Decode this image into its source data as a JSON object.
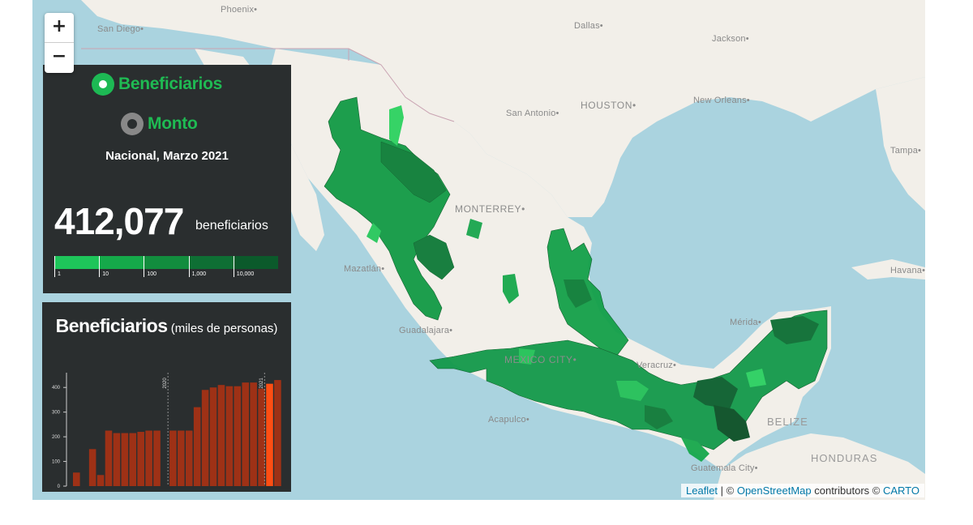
{
  "map": {
    "cities": [
      {
        "name": "Phoenix",
        "cls": "",
        "x": 232,
        "y": 6
      },
      {
        "name": "San Diego",
        "cls": "",
        "x": 80,
        "y": 30
      },
      {
        "name": "Dallas",
        "cls": "",
        "x": 668,
        "y": 26
      },
      {
        "name": "Jackson",
        "cls": "",
        "x": 838,
        "y": 42
      },
      {
        "name": "HOUSTON",
        "cls": "big",
        "x": 676,
        "y": 123
      },
      {
        "name": "San Antonio",
        "cls": "",
        "x": 584,
        "y": 134
      },
      {
        "name": "New Orleans",
        "cls": "",
        "x": 815,
        "y": 118
      },
      {
        "name": "Tampa",
        "cls": "",
        "x": 1058,
        "y": 180
      },
      {
        "name": "MONTERREY",
        "cls": "big",
        "x": 521,
        "y": 251
      },
      {
        "name": "Mazatlán",
        "cls": "",
        "x": 384,
        "y": 326
      },
      {
        "name": "Havana",
        "cls": "",
        "x": 1058,
        "y": 328
      },
      {
        "name": "Guadalajara",
        "cls": "",
        "x": 452,
        "y": 402
      },
      {
        "name": "Mérida",
        "cls": "",
        "x": 860,
        "y": 392
      },
      {
        "name": "MEXICO CITY",
        "cls": "big",
        "x": 582,
        "y": 437
      },
      {
        "name": "Veracruz",
        "cls": "",
        "x": 745,
        "y": 445
      },
      {
        "name": "Acapulco",
        "cls": "",
        "x": 562,
        "y": 512
      },
      {
        "name": "BELIZE",
        "cls": "country",
        "x": 906,
        "y": 513
      },
      {
        "name": "HONDURAS",
        "cls": "country",
        "x": 960,
        "y": 558
      },
      {
        "name": "Guatemala City",
        "cls": "",
        "x": 812,
        "y": 572
      }
    ],
    "attribution": {
      "leaflet": "Leaflet",
      "osm": "OpenStreetMap",
      "mid": " contributors © ",
      "carto": "CARTO",
      "prefix": " | © "
    }
  },
  "zoom": {
    "in": "+",
    "out": "−"
  },
  "panel": {
    "option1": "Beneficiarios",
    "option2": "Monto",
    "selected": "Beneficiarios",
    "subtitle": "Nacional, Marzo 2021",
    "total": "412,077",
    "unit": "beneficiarios",
    "legend_labels": [
      "1",
      "10",
      "100",
      "1,000",
      "10,000"
    ],
    "legend_colors": [
      "#1ec55a",
      "#15a94a",
      "#128d3e",
      "#0e6f34",
      "#0b5a2b"
    ]
  },
  "chart_panel": {
    "title_bold": "Beneficiarios",
    "title_rest": " (miles de personas)"
  },
  "chart_data": {
    "type": "bar",
    "title": "Beneficiarios (miles de personas)",
    "ylim": [
      0,
      450
    ],
    "yticks": [
      0,
      100,
      200,
      300,
      400
    ],
    "year_markers": [
      {
        "label": "2020",
        "index": 12
      },
      {
        "label": "2021",
        "index": 24
      }
    ],
    "values": [
      55,
      0,
      150,
      45,
      225,
      215,
      215,
      215,
      220,
      225,
      225,
      0,
      225,
      225,
      225,
      320,
      390,
      400,
      410,
      405,
      405,
      420,
      420,
      395,
      415,
      430
    ],
    "colors": {
      "bar": "#9e3116",
      "highlight": "#ff4e13",
      "highlight_index": 24
    }
  },
  "colors": {
    "water": "#aad3df",
    "land": "#f2efe9",
    "green_base": "#14a049"
  }
}
